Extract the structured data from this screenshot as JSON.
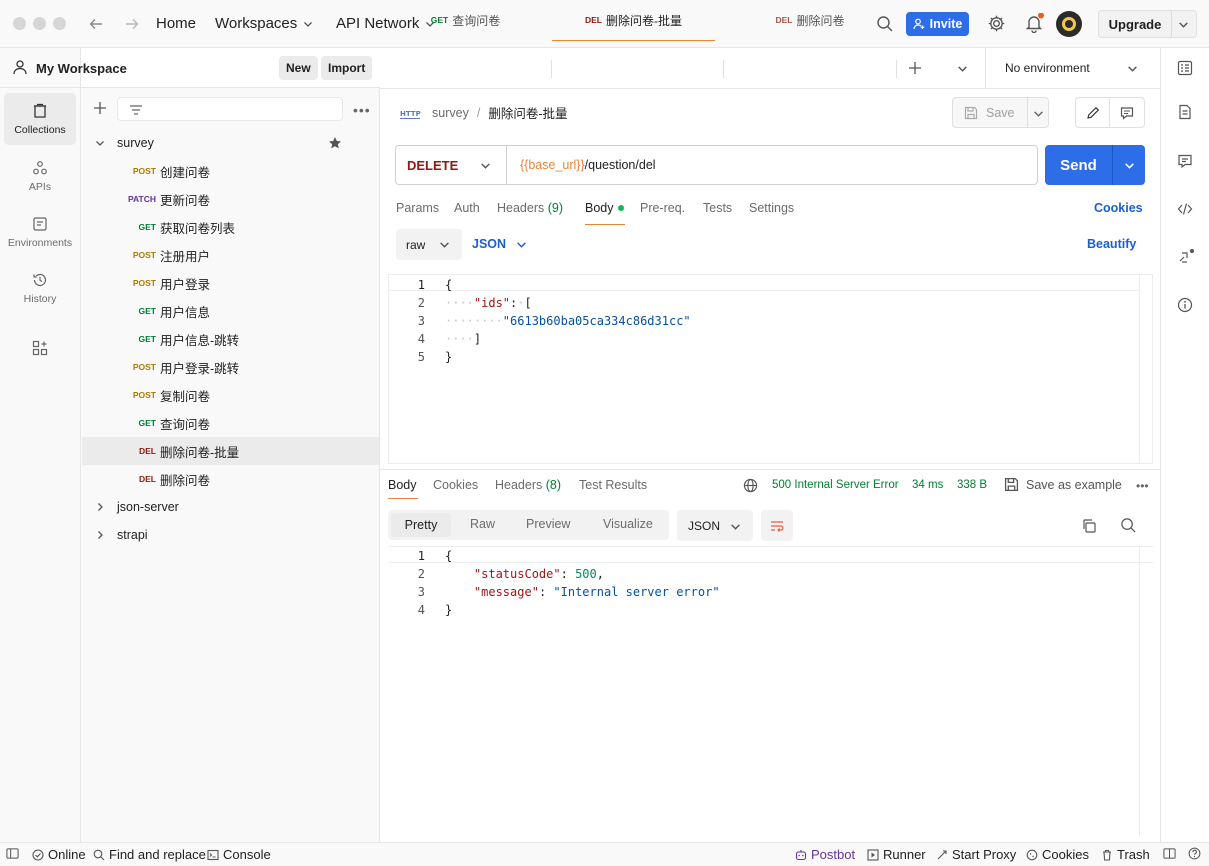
{
  "topbar": {
    "home": "Home",
    "workspaces": "Workspaces",
    "api_network": "API Network",
    "invite": "Invite",
    "upgrade": "Upgrade"
  },
  "rail": {
    "collections": "Collections",
    "apis": "APIs",
    "environments": "Environments",
    "history": "History"
  },
  "sidebar": {
    "workspace": "My Workspace",
    "new": "New",
    "import": "Import",
    "collection": "survey",
    "items": [
      {
        "method": "POST",
        "name": "创建问卷"
      },
      {
        "method": "PATCH",
        "name": "更新问卷"
      },
      {
        "method": "GET",
        "name": "获取问卷列表"
      },
      {
        "method": "POST",
        "name": "注册用户"
      },
      {
        "method": "POST",
        "name": "用户登录"
      },
      {
        "method": "GET",
        "name": "用户信息"
      },
      {
        "method": "GET",
        "name": "用户信息-跳转"
      },
      {
        "method": "POST",
        "name": "用户登录-跳转"
      },
      {
        "method": "POST",
        "name": "复制问卷"
      },
      {
        "method": "GET",
        "name": "查询问卷"
      },
      {
        "method": "DEL",
        "name": "删除问卷-批量"
      },
      {
        "method": "DEL",
        "name": "删除问卷"
      }
    ],
    "other_collections": [
      "json-server",
      "strapi"
    ]
  },
  "tabs": [
    {
      "method": "GET",
      "name": "查询问卷"
    },
    {
      "method": "DEL",
      "name": "删除问卷-批量"
    },
    {
      "method": "DEL",
      "name": "删除问卷"
    }
  ],
  "environment": "No environment",
  "breadcrumb": {
    "parent": "survey",
    "sep": "/",
    "current": "删除问卷-批量"
  },
  "save": "Save",
  "request": {
    "method": "DELETE",
    "url_var": "{{base_url}}",
    "url_path": "/question/del",
    "send": "Send"
  },
  "req_tabs": {
    "params": "Params",
    "auth": "Auth",
    "headers": "Headers",
    "headers_count": "(9)",
    "body": "Body",
    "prereq": "Pre-req.",
    "tests": "Tests",
    "settings": "Settings",
    "cookies": "Cookies"
  },
  "body_opts": {
    "mode": "raw",
    "lang": "JSON",
    "beautify": "Beautify"
  },
  "request_body": {
    "lines": [
      "1",
      "2",
      "3",
      "4",
      "5"
    ],
    "key_ids": "\"ids\"",
    "id_value": "\"6613b60ba05ca334c86d31cc\""
  },
  "response": {
    "tabs": {
      "body": "Body",
      "cookies": "Cookies",
      "headers": "Headers",
      "headers_count": "(8)",
      "test_results": "Test Results"
    },
    "status": "500 Internal Server Error",
    "time": "34 ms",
    "size": "338 B",
    "save_example": "Save as example",
    "views": {
      "pretty": "Pretty",
      "raw": "Raw",
      "preview": "Preview",
      "visualize": "Visualize"
    },
    "format": "JSON",
    "lines": [
      "1",
      "2",
      "3",
      "4"
    ],
    "key_status": "\"statusCode\"",
    "val_status": "500",
    "key_message": "\"message\"",
    "val_message": "\"Internal server error\""
  },
  "statusbar": {
    "online": "Online",
    "find_replace": "Find and replace",
    "console": "Console",
    "postbot": "Postbot",
    "runner": "Runner",
    "start_proxy": "Start Proxy",
    "cookies": "Cookies",
    "trash": "Trash"
  }
}
